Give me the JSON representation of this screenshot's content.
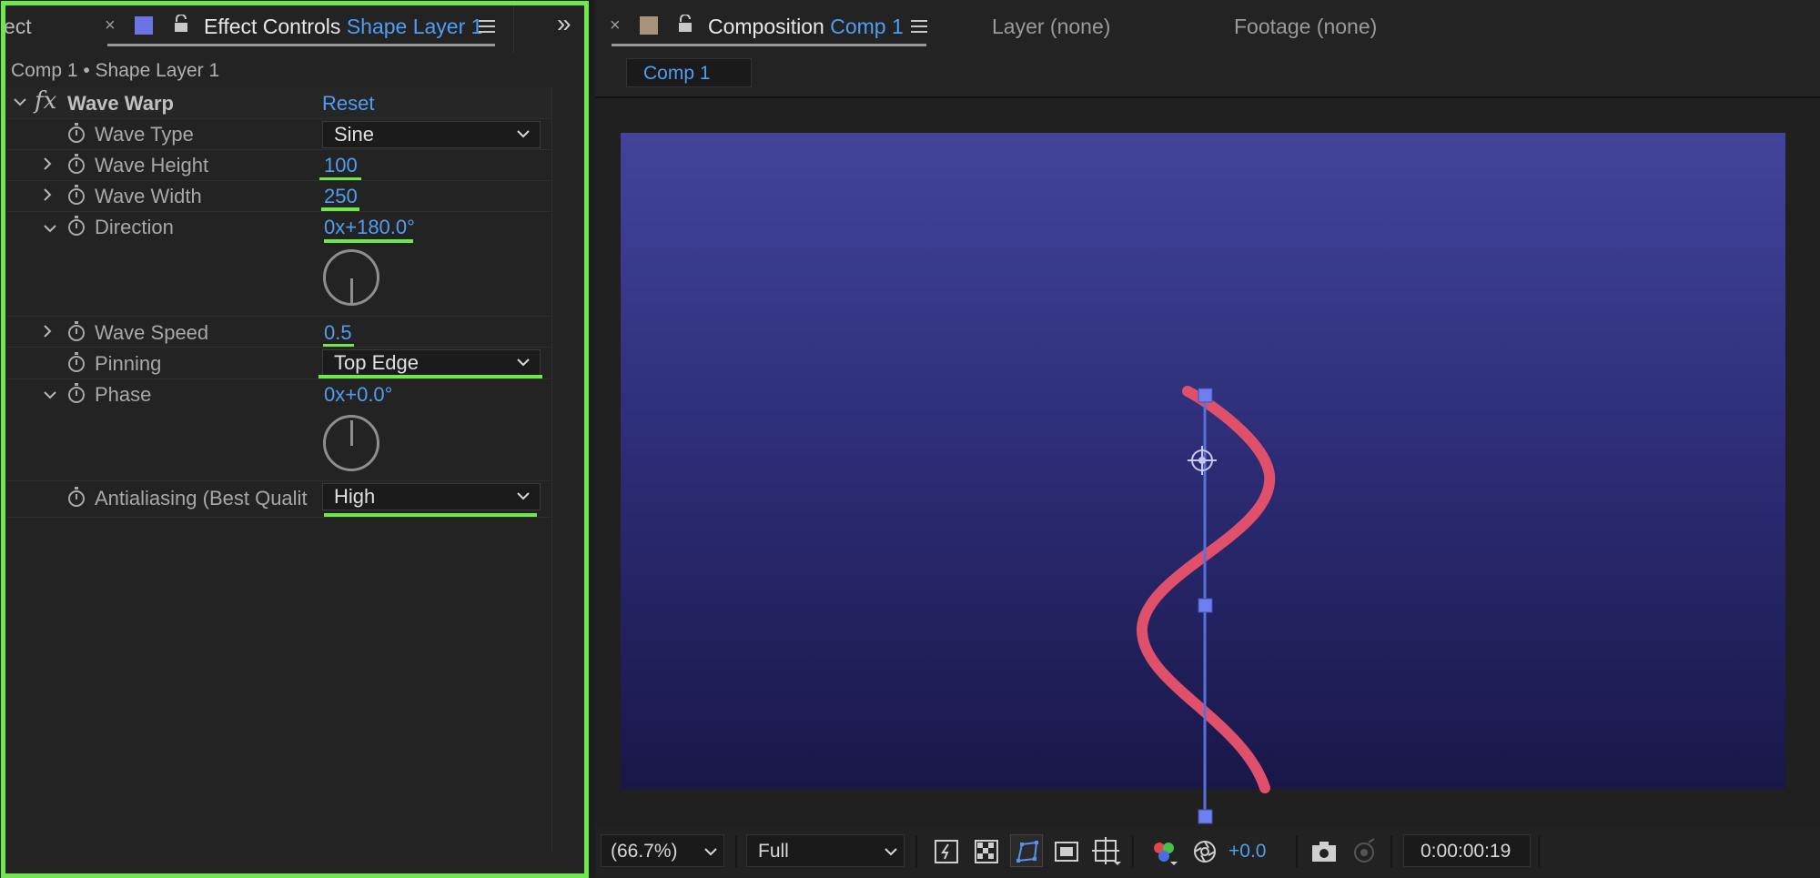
{
  "left_panel": {
    "prev_tab_text": "ect",
    "close_glyph": "×",
    "tab_title": "Effect Controls",
    "tab_layer": "Shape Layer 1",
    "more_glyph": "»",
    "breadcrumb": "Comp 1 • Shape Layer 1",
    "effect": {
      "fx_glyph": "fx",
      "name": "Wave Warp",
      "reset_label": "Reset"
    },
    "properties": {
      "wave_type": {
        "label": "Wave Type",
        "value": "Sine"
      },
      "wave_height": {
        "label": "Wave Height",
        "value": "100"
      },
      "wave_width": {
        "label": "Wave Width",
        "value": "250"
      },
      "direction": {
        "label": "Direction",
        "value": "0x+180.0°"
      },
      "wave_speed": {
        "label": "Wave Speed",
        "value": "0.5"
      },
      "pinning": {
        "label": "Pinning",
        "value": "Top Edge"
      },
      "phase": {
        "label": "Phase",
        "value": "0x+0.0°"
      },
      "antialiasing": {
        "label": "Antialiasing (Best Qualit",
        "value": "High"
      }
    },
    "colors": {
      "highlight": "#6ee84a",
      "value_blue": "#4f9ef2",
      "layer_label": "#6b74e0"
    }
  },
  "right_panel": {
    "close_glyph": "×",
    "comp_tab_title": "Composition",
    "comp_tab_name": "Comp 1",
    "layer_tab": "Layer (none)",
    "footage_tab": "Footage (none)",
    "sub_tab": "Comp 1",
    "toolbar": {
      "zoom": "(66.7%)",
      "resolution": "Full",
      "exposure": "+0.0",
      "timecode": "0:00:00:19"
    },
    "colors": {
      "canvas_top": "#42449a",
      "canvas_bottom": "#191748",
      "wave_stroke": "#e0506a",
      "path_line": "#5b6fd8",
      "label_swatch": "#a8927a"
    }
  }
}
